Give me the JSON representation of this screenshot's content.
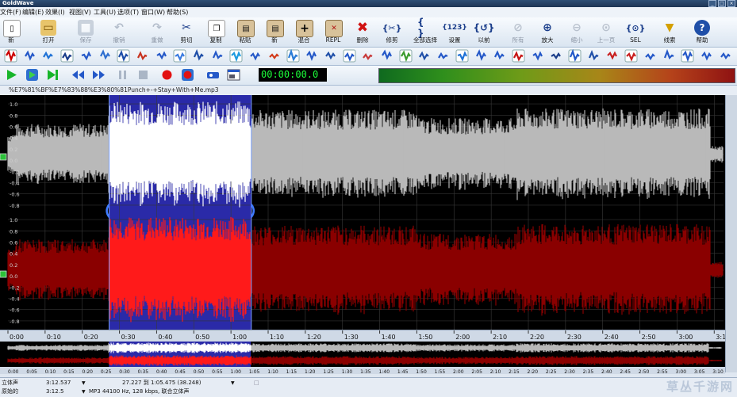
{
  "window": {
    "title": "GoldWave"
  },
  "menu": [
    "文件(F)",
    "编辑(E)",
    "效果(I)",
    "视图(V)",
    "工具(U)",
    "选项(T)",
    "窗口(W)",
    "帮助(S)"
  ],
  "toolbar": {
    "buttons": [
      {
        "label": "新",
        "icon": "new-file-icon",
        "enabled": true
      },
      {
        "label": "打开",
        "icon": "open-folder-icon",
        "enabled": true
      },
      {
        "label": "保存",
        "icon": "save-icon",
        "enabled": false
      },
      {
        "label": "撤销",
        "icon": "undo-icon",
        "enabled": false
      },
      {
        "label": "重做",
        "icon": "redo-icon",
        "enabled": false
      },
      {
        "label": "剪切",
        "icon": "cut-icon",
        "enabled": true
      },
      {
        "label": "复制",
        "icon": "copy-icon",
        "enabled": true
      },
      {
        "label": "粘贴",
        "icon": "paste-icon",
        "enabled": true
      },
      {
        "label": "新",
        "icon": "paste-new-icon",
        "enabled": true
      },
      {
        "label": "混合",
        "icon": "mix-icon",
        "enabled": true
      },
      {
        "label": "REPL",
        "icon": "replace-icon",
        "enabled": true
      },
      {
        "label": "删除",
        "icon": "delete-icon",
        "enabled": true
      },
      {
        "label": "修剪",
        "icon": "trim-icon",
        "enabled": true
      },
      {
        "label": "全部选择",
        "icon": "select-all-icon",
        "enabled": true
      },
      {
        "label": "设置",
        "icon": "set-icon",
        "enabled": true
      },
      {
        "label": "以前",
        "icon": "previous-icon",
        "enabled": true
      },
      {
        "label": "所有",
        "icon": "view-all-icon",
        "enabled": false
      },
      {
        "label": "放大",
        "icon": "zoom-in-icon",
        "enabled": true
      },
      {
        "label": "缩小",
        "icon": "zoom-out-icon",
        "enabled": false
      },
      {
        "label": "上一页",
        "icon": "previous-page-icon",
        "enabled": false
      },
      {
        "label": "SEL",
        "icon": "zoom-selection-icon",
        "enabled": true
      },
      {
        "label": "线索",
        "icon": "cue-icon",
        "enabled": true
      },
      {
        "label": "帮助",
        "icon": "help-icon",
        "enabled": true
      }
    ]
  },
  "time_display": "00:00:00.0",
  "file": {
    "title": "%E7%81%BF%E7%83%88%E3%80%81Punch+-+Stay+With+Me.mp3"
  },
  "channels": [
    {
      "name": "left",
      "color": "#b9b9b9",
      "selected_color": "#ffffff"
    },
    {
      "name": "right",
      "color": "#8a0000",
      "selected_color": "#ff1a1a"
    }
  ],
  "selection": {
    "start_seconds": 27.227,
    "end_seconds": 65.475,
    "length_seconds": 38.248
  },
  "duration_seconds": 192.5,
  "amplitude_labels": [
    "1.0",
    "0.8",
    "0.6",
    "0.4",
    "0.2",
    "0.0",
    "-0.2",
    "-0.4",
    "-0.6",
    "-0.8"
  ],
  "ruler_labels": [
    "0:00",
    "0:10",
    "0:20",
    "0:30",
    "0:40",
    "0:50",
    "1:00",
    "1:10",
    "1:20",
    "1:30",
    "1:40",
    "1:50",
    "2:00",
    "2:10",
    "2:20",
    "2:30",
    "2:40",
    "2:50",
    "3:00",
    "3:1"
  ],
  "overview_labels": [
    "0:00",
    "0:05",
    "0:10",
    "0:15",
    "0:20",
    "0:25",
    "0:30",
    "0:35",
    "0:40",
    "0:45",
    "0:50",
    "0:55",
    "1:00",
    "1:05",
    "1:10",
    "1:15",
    "1:20",
    "1:25",
    "1:30",
    "1:35",
    "1:40",
    "1:45",
    "1:50",
    "1:55",
    "2:00",
    "2:05",
    "2:10",
    "2:15",
    "2:20",
    "2:25",
    "2:30",
    "2:35",
    "2:40",
    "2:45",
    "2:50",
    "2:55",
    "3:00",
    "3:05",
    "3:10"
  ],
  "status": {
    "channels": "立体声",
    "duration": "3:12.537",
    "selection": "27.227 到 1:05.475 (38.248)",
    "original_label": "原始的",
    "original_duration": "3:12.5",
    "format": "MP3 44100 Hz, 128 kbps, 联合立体声"
  },
  "watermark": "草丛千游网"
}
